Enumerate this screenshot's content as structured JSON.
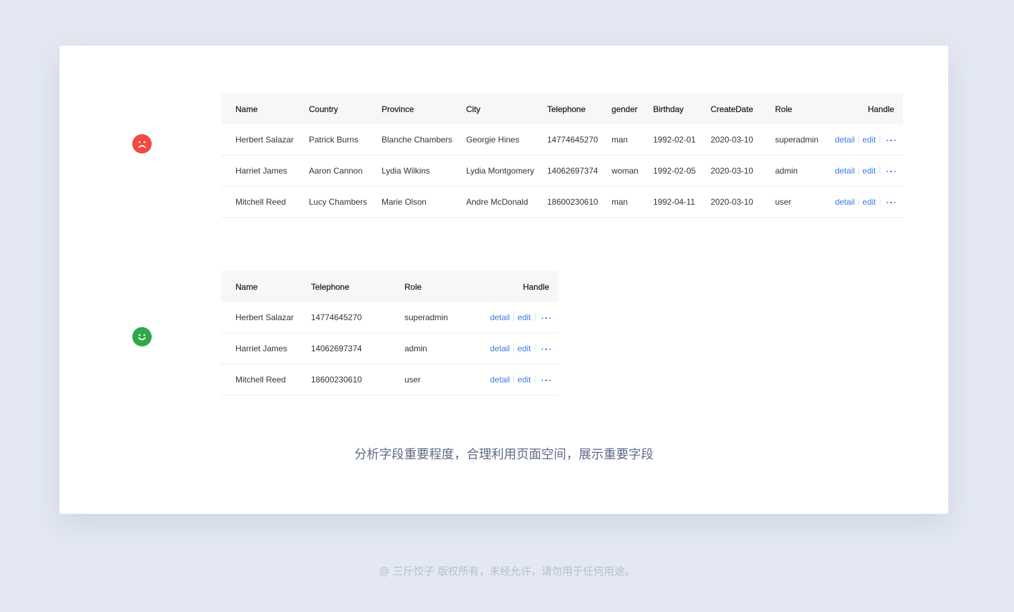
{
  "colors": {
    "background": "#e3e8f2",
    "card": "#ffffff",
    "header_bg": "#f6f7f9",
    "link": "#3b7be0",
    "sad_face": "#f04a43",
    "happy_face": "#2fa84a",
    "caption": "#5d6a86",
    "footer": "#b8bfcc"
  },
  "bad_example": {
    "indicator_icon": "sad-face-icon",
    "headers": [
      "Name",
      "Country",
      "Province",
      "City",
      "Telephone",
      "gender",
      "Birthday",
      "CreateDate",
      "Role",
      "Handle"
    ],
    "rows": [
      [
        "Herbert Salazar",
        "Patrick Burns",
        "Blanche Chambers",
        "Georgie Hines",
        "14774645270",
        "man",
        "1992-02-01",
        "2020-03-10",
        "superadmin"
      ],
      [
        "Harriet James",
        "Aaron Cannon",
        "Lydia Wilkins",
        "Lydia Montgomery",
        "14062697374",
        "woman",
        "1992-02-05",
        "2020-03-10",
        "admin"
      ],
      [
        "Mitchell Reed",
        "Lucy Chambers",
        "Marie Olson",
        "Andre McDonald",
        "18600230610",
        "man",
        "1992-04-11",
        "2020-03-10",
        "user"
      ]
    ]
  },
  "good_example": {
    "indicator_icon": "happy-face-icon",
    "headers": [
      "Name",
      "Telephone",
      "Role",
      "Handle"
    ],
    "rows": [
      [
        "Herbert Salazar",
        "14774645270",
        "superadmin"
      ],
      [
        "Harriet James",
        "14062697374",
        "admin"
      ],
      [
        "Mitchell Reed",
        "18600230610",
        "user"
      ]
    ]
  },
  "actions": {
    "detail": "detail",
    "edit": "edit",
    "more_icon": "more-dots-icon"
  },
  "caption": "分析字段重要程度，合理利用页面空间，展示重要字段",
  "footer": "@ 三斤饺子  版权所有，未经允许，请勿用于任何用途。"
}
